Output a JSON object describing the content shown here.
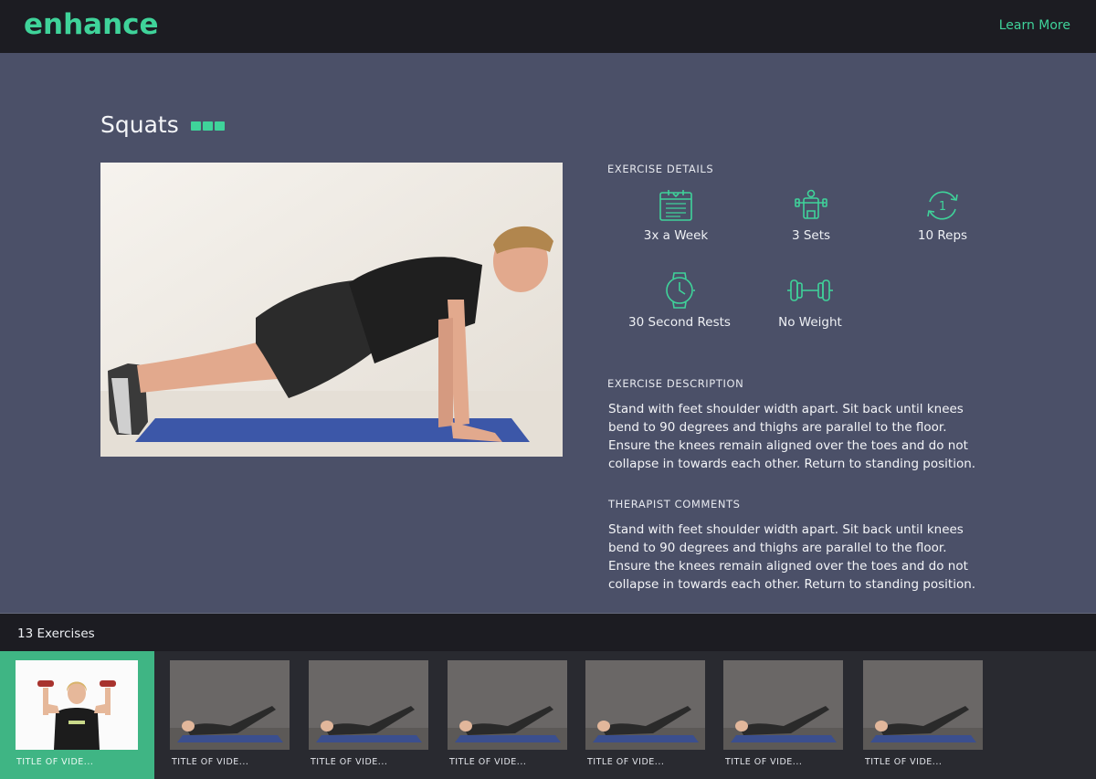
{
  "header": {
    "logo": "enhance",
    "learn_more": "Learn More"
  },
  "exercise": {
    "title": "Squats",
    "difficulty_level": 3,
    "difficulty_max": 3
  },
  "details": {
    "heading": "EXERCISE DETAILS",
    "items": [
      {
        "icon": "calendar-icon",
        "label": "3x a Week"
      },
      {
        "icon": "sets-icon",
        "label": "3 Sets"
      },
      {
        "icon": "repeat-icon",
        "label": "10 Reps"
      },
      {
        "icon": "stopwatch-icon",
        "label": "30 Second Rests"
      },
      {
        "icon": "dumbbell-icon",
        "label": "No Weight"
      }
    ]
  },
  "description": {
    "heading": "EXERCISE DESCRIPTION",
    "text": "Stand with feet shoulder width apart. Sit back until knees bend to 90 degrees and thighs are parallel to the floor. Ensure the knees remain aligned over the toes and do not collapse in towards each other. Return to standing position."
  },
  "comments": {
    "heading": "THERAPIST COMMENTS",
    "text": "Stand with feet shoulder width apart. Sit back until knees bend to 90 degrees and thighs are parallel to the floor. Ensure the knees remain aligned over the toes and do not collapse in towards each other. Return to standing position."
  },
  "playlist": {
    "count_label": "13 Exercises",
    "items": [
      {
        "title": "TITLE OF VIDE...",
        "active": true
      },
      {
        "title": "TITLE OF VIDE...",
        "active": false
      },
      {
        "title": "TITLE OF VIDE...",
        "active": false
      },
      {
        "title": "TITLE OF VIDE...",
        "active": false
      },
      {
        "title": "TITLE OF VIDE...",
        "active": false
      },
      {
        "title": "TITLE OF VIDE...",
        "active": false
      },
      {
        "title": "TITLE OF VIDE...",
        "active": false
      }
    ]
  },
  "colors": {
    "accent": "#3fd39a",
    "background": "#4b5068",
    "header": "#1c1c22",
    "active_thumb": "#3fb584"
  }
}
